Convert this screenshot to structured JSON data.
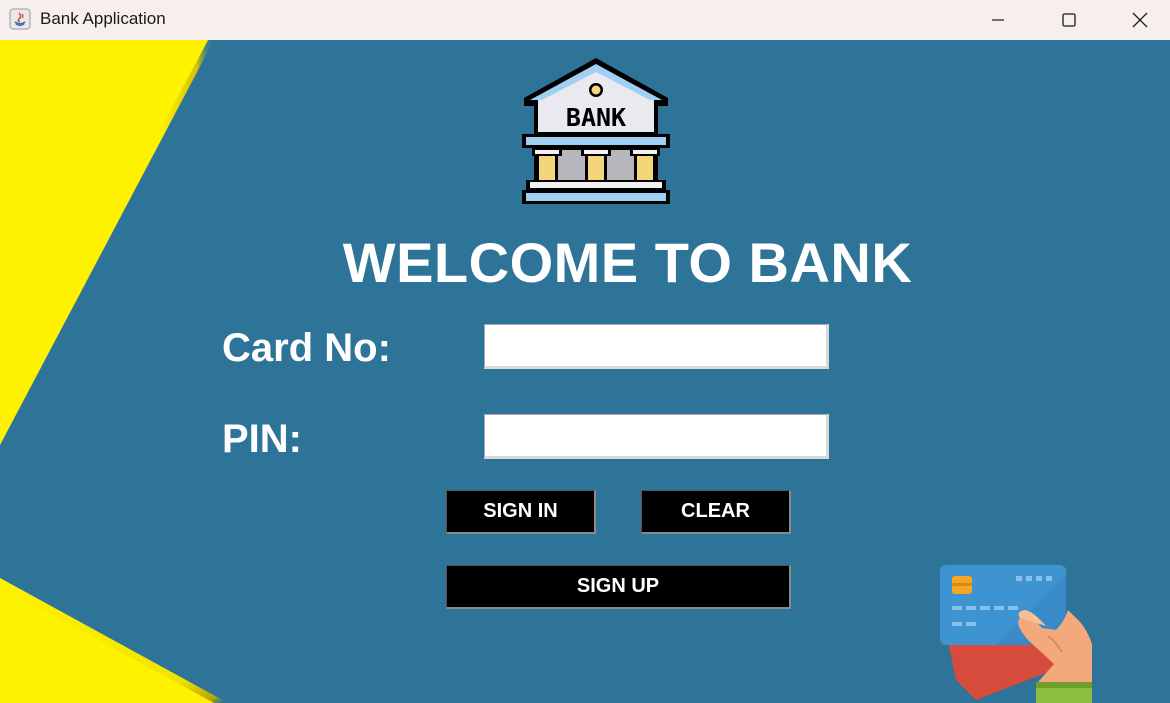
{
  "window": {
    "title": "Bank Application",
    "controls": {
      "minimize": "minimize",
      "maximize": "maximize",
      "close": "close"
    }
  },
  "logo": {
    "text": "BANK",
    "icon": "bank-building-icon"
  },
  "heading": "WELCOME TO BANK",
  "form": {
    "card_label": "Card No:",
    "card_value": "",
    "pin_label": "PIN:",
    "pin_value": ""
  },
  "buttons": {
    "sign_in": "SIGN IN",
    "clear": "CLEAR",
    "sign_up": "SIGN UP"
  },
  "illustration": {
    "icon": "hand-holding-cards-icon"
  },
  "colors": {
    "background": "#2e7499",
    "accent": "#ffef00",
    "button": "#000000",
    "text": "#ffffff"
  }
}
